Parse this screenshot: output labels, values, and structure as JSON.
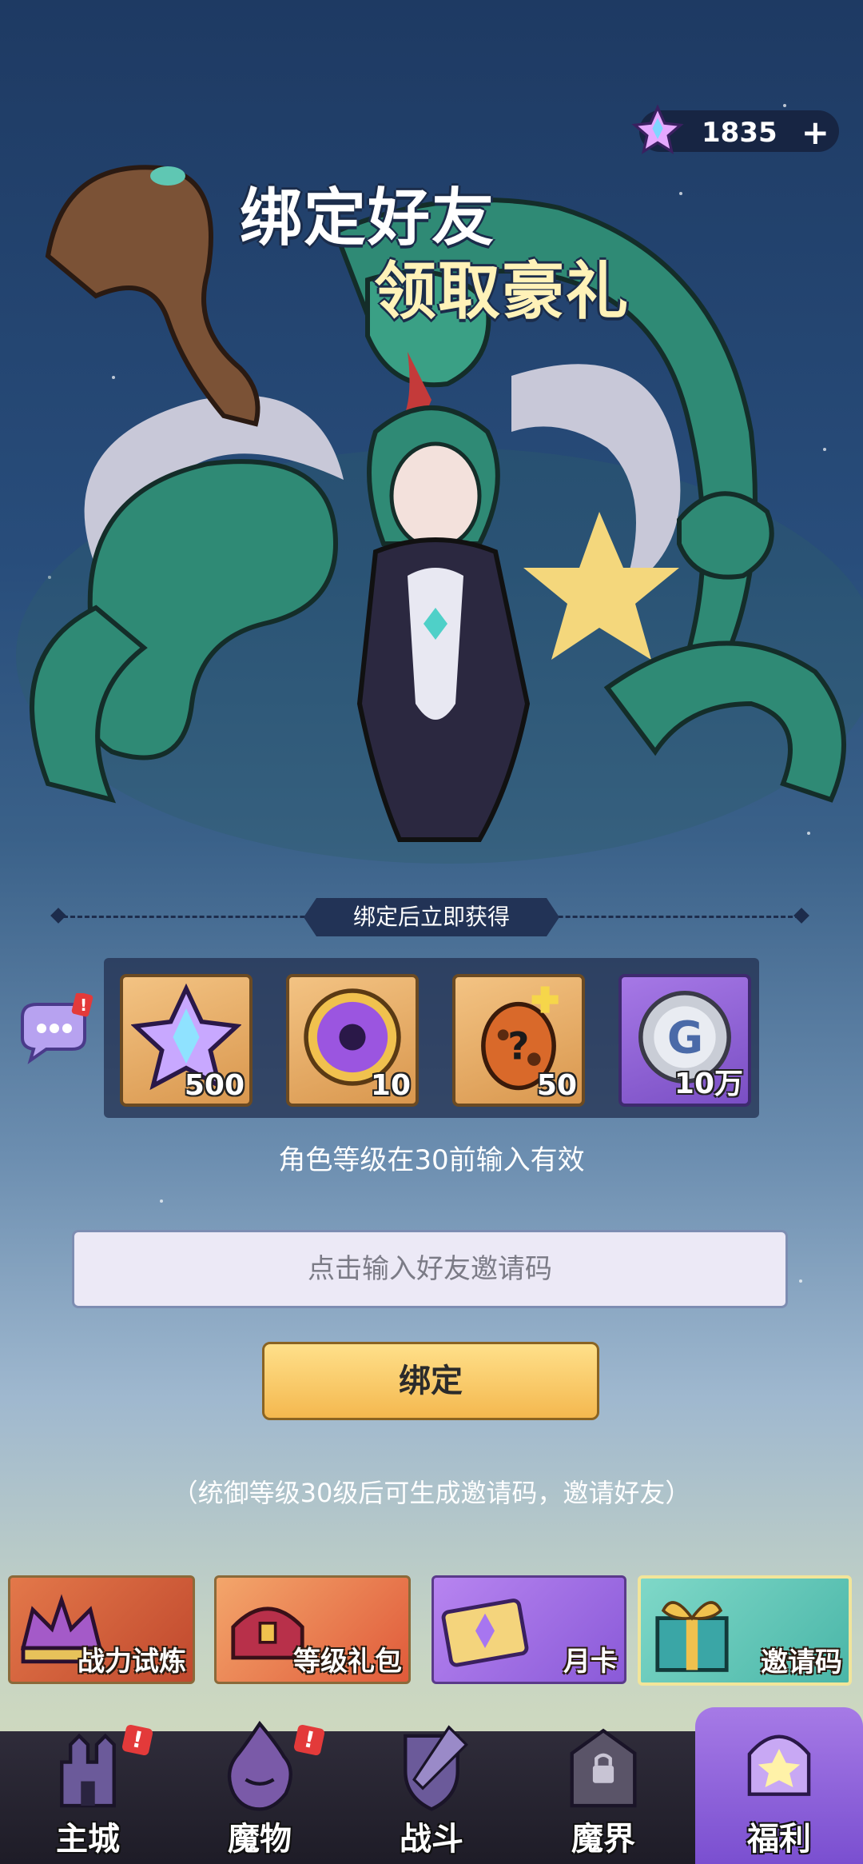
{
  "currency": {
    "value": "1835",
    "plus": "+"
  },
  "banner": {
    "line1": "绑定好友",
    "line2": "领取豪礼"
  },
  "rewards": {
    "header": "绑定后立即获得",
    "items": [
      {
        "name": "star-crystal",
        "count": "500"
      },
      {
        "name": "purple-orb",
        "count": "10"
      },
      {
        "name": "mystery-egg",
        "count": "50"
      },
      {
        "name": "silver-coin",
        "count": "10万"
      }
    ]
  },
  "level_note": "角色等级在30前输入有效",
  "invite_input": {
    "placeholder": "点击输入好友邀请码"
  },
  "bind_button": "绑定",
  "generate_note": "（统御等级30级后可生成邀请码，邀请好友）",
  "features": [
    {
      "label": "战力试炼"
    },
    {
      "label": "等级礼包"
    },
    {
      "label": "月卡"
    },
    {
      "label": "邀请码"
    }
  ],
  "nav": [
    {
      "label": "主城",
      "badge": "!"
    },
    {
      "label": "魔物",
      "badge": "!"
    },
    {
      "label": "战斗"
    },
    {
      "label": "魔界"
    },
    {
      "label": "福利"
    }
  ],
  "colors": {
    "accent_gold": "#f4b84f",
    "nav_active": "#8a5ee0"
  }
}
